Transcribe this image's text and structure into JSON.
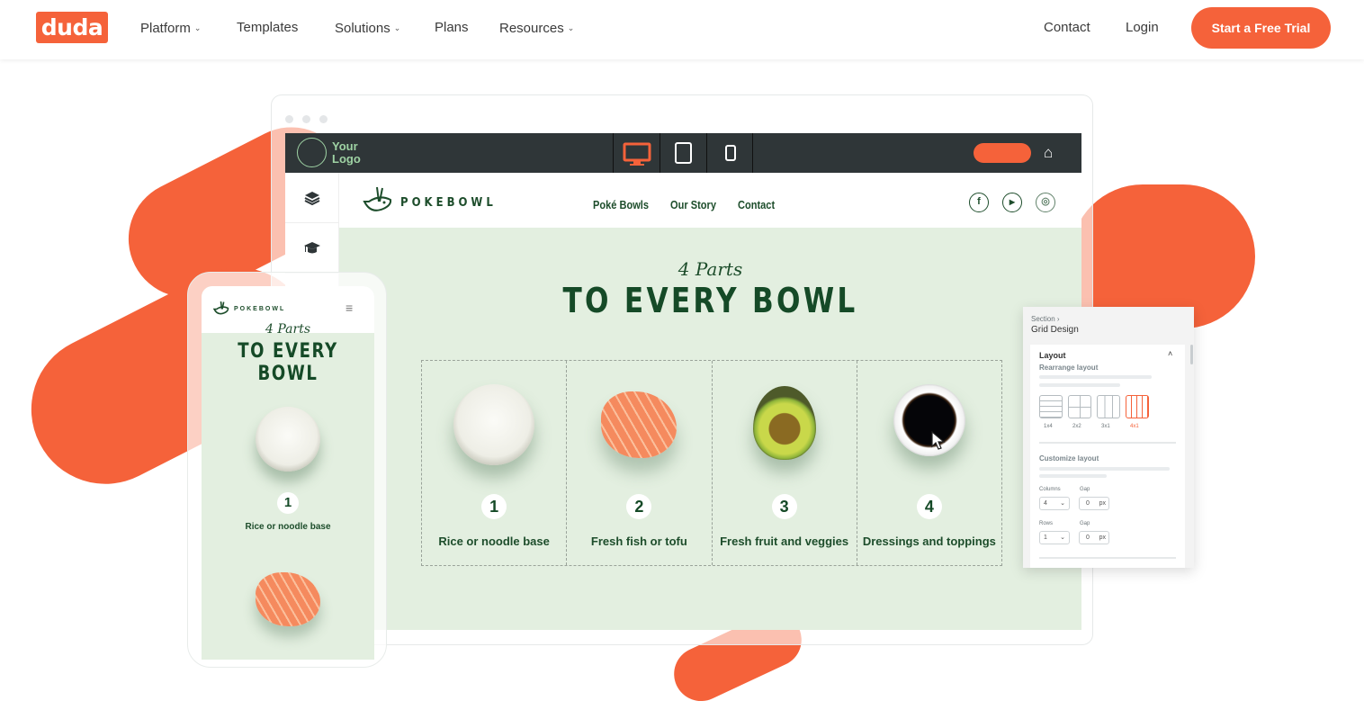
{
  "nav": {
    "brand": "duda",
    "items": [
      {
        "label": "Platform",
        "has_dropdown": true
      },
      {
        "label": "Templates",
        "has_dropdown": false
      },
      {
        "label": "Solutions",
        "has_dropdown": true
      },
      {
        "label": "Plans",
        "has_dropdown": false
      },
      {
        "label": "Resources",
        "has_dropdown": true
      }
    ],
    "right": {
      "contact": "Contact",
      "login": "Login",
      "cta": "Start a Free Trial"
    },
    "chevron": "⌄"
  },
  "colors": {
    "brand": "#f5623a",
    "editor_bar": "#2f3638",
    "site_bg": "#e3efe0",
    "site_green": "#154a27"
  },
  "editor": {
    "logo_text_1": "Your",
    "logo_text_2": "Logo",
    "devices": [
      "desktop-icon",
      "tablet-icon",
      "mobile-icon"
    ],
    "active_device": "desktop",
    "home_icon": "⌂",
    "side_tools": [
      {
        "icon": "layers-icon",
        "glyph": "≋"
      },
      {
        "icon": "graduation-cap-icon",
        "glyph": "🎓"
      }
    ]
  },
  "site": {
    "brand": "POKEBOWL",
    "nav": [
      "Poké Bowls",
      "Our Story",
      "Contact"
    ],
    "social": [
      {
        "name": "facebook",
        "glyph": "f"
      },
      {
        "name": "youtube",
        "glyph": "▶"
      },
      {
        "name": "instagram",
        "glyph": "◎"
      }
    ],
    "script_title": "4 Parts",
    "headline": "TO EVERY BOWL",
    "steps": [
      {
        "num": "1",
        "caption": "Rice or noodle base",
        "food": "rice bowl"
      },
      {
        "num": "2",
        "caption": "Fresh fish or tofu",
        "food": "salmon slices"
      },
      {
        "num": "3",
        "caption": "Fresh fruit and veggies",
        "food": "avocado"
      },
      {
        "num": "4",
        "caption": "Dressings and toppings",
        "food": "soy sauce"
      }
    ]
  },
  "mobile": {
    "brand": "POKEBOWL",
    "menu_icon": "≡",
    "script_title": "4 Parts",
    "headline": "TO EVERY BOWL",
    "step_num": "1",
    "step_caption": "Rice or noodle base"
  },
  "panel": {
    "breadcrumb": "Section ›",
    "title": "Grid Design",
    "section": "Layout",
    "rearrange_label": "Rearrange layout",
    "layouts": [
      "1x4",
      "2x2",
      "3x1",
      "4x1"
    ],
    "selected_layout": "4x1",
    "customize_label": "Customize layout",
    "columns_label": "Columns",
    "columns_value": "4",
    "gap_label": "Gap",
    "col_gap_value": "0",
    "rows_label": "Rows",
    "rows_value": "1",
    "row_gap_value": "0",
    "unit": "px"
  }
}
